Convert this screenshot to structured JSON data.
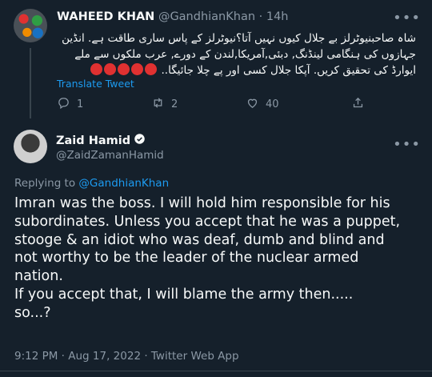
{
  "parent_tweet": {
    "author_name": "WAHEED KHAN",
    "meta": "@GandhianKhan · 14h",
    "text": "شاہ صاحبنیوٹرلز بے جلال کیوں نہیں آتا؟نیوٹرلز کے پاس ساری طاقت ہے. انڈین جہازوں کی ہنگامی لینڈنگ, دبئی,آمریکا,لندن کے دورے, عرب ملکوں سے ملے ایوارڈ کی تحقیق کریں. آپکا جلال کسی اور پے چلا جائیگا..",
    "emojis": "😡😡😡😡😡",
    "translate_label": "Translate Tweet",
    "actions": {
      "replies": "1",
      "retweets": "2",
      "likes": "40"
    }
  },
  "main_tweet": {
    "author_name": "Zaid Hamid",
    "handle": "@ZaidZamanHamid",
    "replying_prefix": "Replying to",
    "replying_handle": "@GandhianKhan",
    "text_lines": [
      "Imran was the boss. I will hold him responsible for his",
      "subordinates. Unless you accept that he was a puppet,",
      "stooge & an idiot who was deaf, dumb and blind and",
      "not worthy to be the leader of the nuclear armed",
      "nation.",
      "If you accept that, I will blame the army then.....",
      "so...?"
    ],
    "timestamp": "9:12 PM · Aug 17, 2022 · Twitter Web App"
  },
  "colors": {
    "background": "#15202b",
    "text": "#f7f9f9",
    "muted": "#8b98a5",
    "accent": "#1d9bf0"
  }
}
